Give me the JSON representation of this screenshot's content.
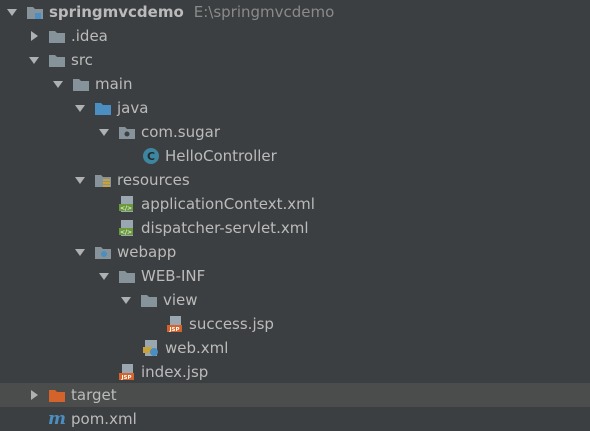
{
  "project_tree": {
    "root": {
      "label": "springmvcdemo",
      "path": "E:\\springmvcdemo"
    },
    "nodes": [
      {
        "label": ".idea",
        "icon": "folder-icon",
        "expanded": false
      },
      {
        "label": "src",
        "icon": "folder-icon",
        "expanded": true
      },
      {
        "label": "main",
        "icon": "folder-icon",
        "expanded": true
      },
      {
        "label": "java",
        "icon": "source-folder-icon",
        "expanded": true
      },
      {
        "label": "com.sugar",
        "icon": "package-icon",
        "expanded": true
      },
      {
        "label": "HelloController",
        "icon": "class-icon"
      },
      {
        "label": "resources",
        "icon": "resources-folder-icon",
        "expanded": true
      },
      {
        "label": "applicationContext.xml",
        "icon": "spring-xml-icon"
      },
      {
        "label": "dispatcher-servlet.xml",
        "icon": "spring-xml-icon"
      },
      {
        "label": "webapp",
        "icon": "web-folder-icon",
        "expanded": true
      },
      {
        "label": "WEB-INF",
        "icon": "folder-icon",
        "expanded": true
      },
      {
        "label": "view",
        "icon": "folder-icon",
        "expanded": true
      },
      {
        "label": "success.jsp",
        "icon": "jsp-file-icon"
      },
      {
        "label": "web.xml",
        "icon": "web-xml-icon"
      },
      {
        "label": "index.jsp",
        "icon": "jsp-file-icon"
      },
      {
        "label": "target",
        "icon": "excluded-folder-icon",
        "expanded": false
      },
      {
        "label": "pom.xml",
        "icon": "maven-pom-icon"
      }
    ]
  },
  "colors": {
    "background": "#3c3f41",
    "highlight": "#4b4d4d",
    "text": "#bbbbbb",
    "path_text": "#8a8a8a",
    "folder": "#87939a",
    "source_folder": "#4a8ec2",
    "excluded_folder": "#d3622b",
    "class_icon": "#3e86a0"
  }
}
